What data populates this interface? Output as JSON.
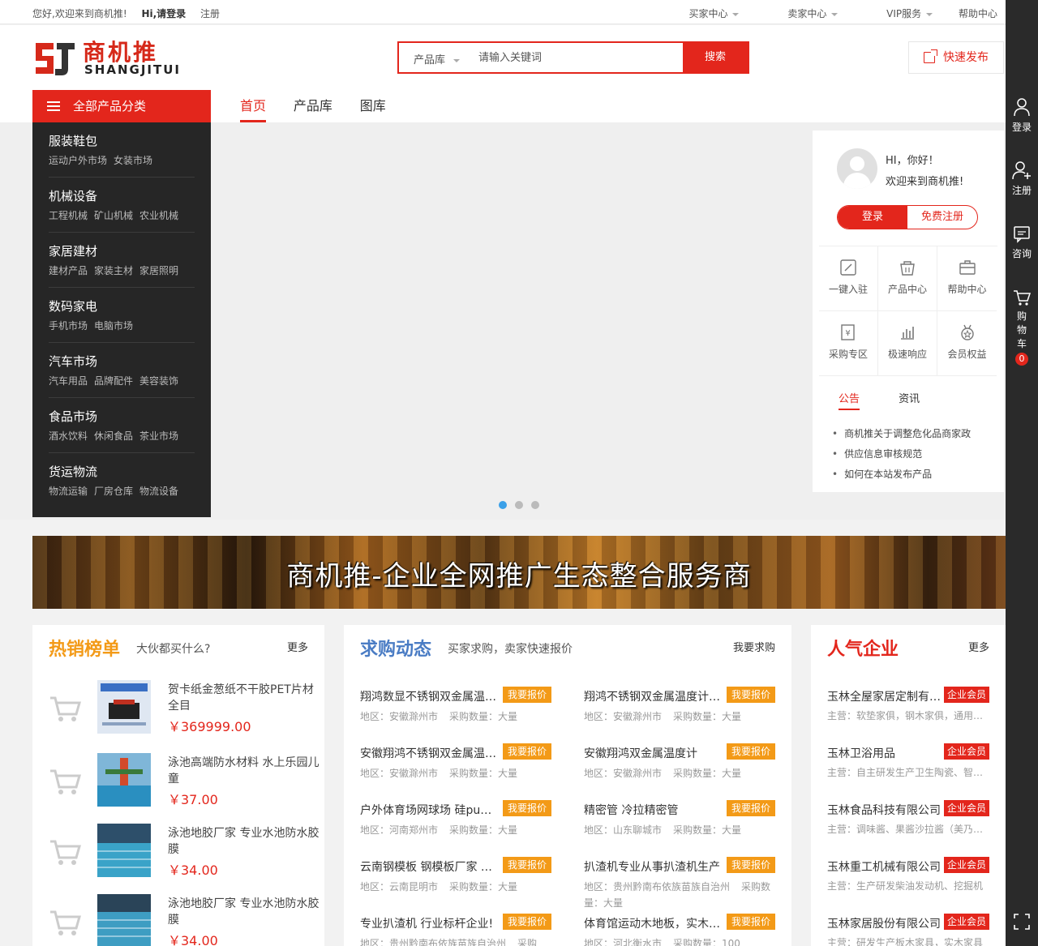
{
  "topbar": {
    "welcome": "您好,欢迎来到商机推!",
    "login": "Hi,请登录",
    "register": "注册",
    "menus": [
      "买家中心",
      "卖家中心",
      "VIP服务",
      "帮助中心"
    ]
  },
  "header": {
    "logo_cn": "商机推",
    "logo_en": "SHANGJITUI",
    "search_category": "产品库",
    "search_placeholder": "请输入关键词",
    "search_button": "搜索",
    "publish_button": "快速发布"
  },
  "nav": {
    "all_categories": "全部产品分类",
    "tabs": [
      "首页",
      "产品库",
      "图库"
    ]
  },
  "categories": [
    {
      "title": "服装鞋包",
      "subs": [
        "运动户外市场",
        "女装市场"
      ]
    },
    {
      "title": "机械设备",
      "subs": [
        "工程机械",
        "矿山机械",
        "农业机械"
      ]
    },
    {
      "title": "家居建材",
      "subs": [
        "建材产品",
        "家装主材",
        "家居照明"
      ]
    },
    {
      "title": "数码家电",
      "subs": [
        "手机市场",
        "电脑市场"
      ]
    },
    {
      "title": "汽车市场",
      "subs": [
        "汽车用品",
        "品牌配件",
        "美容装饰"
      ]
    },
    {
      "title": "食品市场",
      "subs": [
        "酒水饮料",
        "休闲食品",
        "茶业市场"
      ]
    },
    {
      "title": "货运物流",
      "subs": [
        "物流运输",
        "厂房仓库",
        "物流设备"
      ]
    }
  ],
  "user_panel": {
    "greeting1": "HI，你好！",
    "greeting2": "欢迎来到商机推!",
    "login": "登录",
    "register": "免费注册",
    "grid": [
      "一键入驻",
      "产品中心",
      "帮助中心",
      "采购专区",
      "极速响应",
      "会员权益"
    ],
    "tabs": [
      "公告",
      "资讯"
    ],
    "notices": [
      "商机推关于调整危化品商家政",
      "供应信息审核规范",
      "如何在本站发布产品"
    ]
  },
  "banner_text": "商机推-企业全网推广生态整合服务商",
  "hot": {
    "title": "热销榜单",
    "subtitle": "大伙都买什么?",
    "more": "更多",
    "items": [
      {
        "name": "贺卡纸金葱纸不干胶PET片材全目",
        "price": "￥369999.00"
      },
      {
        "name": "泳池高端防水材料 水上乐园儿童",
        "price": "￥37.00"
      },
      {
        "name": "泳池地胶厂家 专业水池防水胶膜",
        "price": "￥34.00"
      },
      {
        "name": "泳池地胶厂家 专业水池防水胶膜",
        "price": "￥34.00"
      }
    ]
  },
  "buy": {
    "title": "求购动态",
    "subtitle": "买家求购，卖家快速报价",
    "more": "我要求购",
    "quote_label": "我要报价",
    "items": [
      {
        "name": "翔鸿数显不锈钢双金属温度计",
        "region": "地区：安徽滁州市",
        "qty": "采购数量：大量"
      },
      {
        "name": "翔鸿不锈钢双金属温度计厂家",
        "region": "地区：安徽滁州市",
        "qty": "采购数量：大量"
      },
      {
        "name": "安徽翔鸿不锈钢双金属温度计",
        "region": "地区：安徽滁州市",
        "qty": "采购数量：大量"
      },
      {
        "name": "安徽翔鸿双金属温度计",
        "region": "地区：安徽滁州市",
        "qty": "采购数量：大量"
      },
      {
        "name": "户外体育场网球场 硅pu运动地面",
        "region": "地区：河南郑州市",
        "qty": "采购数量：大量"
      },
      {
        "name": "精密管 冷拉精密管",
        "region": "地区：山东聊城市",
        "qty": "采购数量：大量"
      },
      {
        "name": "云南钢模板 钢模板厂家 钢模板",
        "region": "地区：云南昆明市",
        "qty": "采购数量：大量"
      },
      {
        "name": "扒渣机专业从事扒渣机生产",
        "region": "地区：贵州黔南布依族苗族自治州",
        "qty": "采购数量：大量"
      },
      {
        "name": "专业扒渣机 行业标杆企业!",
        "region": "地区：贵州黔南布依族苗族自治州",
        "qty": "采购数"
      },
      {
        "name": "体育馆运动木地板，实木运动地板",
        "region": "地区：河北衡水市",
        "qty": "采购数量：100"
      }
    ]
  },
  "pop": {
    "title": "人气企业",
    "more": "更多",
    "vip_label": "企业会员",
    "items": [
      {
        "name": "玉林全屋家居定制有限公司",
        "main": "主营：软垫家俱，钢木家俱，通用家具"
      },
      {
        "name": "玉林卫浴用品",
        "main": "主营：自主研发生产卫生陶瓷、智能马桶"
      },
      {
        "name": "玉林食品科技有限公司",
        "main": "主营：调味酱、果酱沙拉酱（美乃滋）"
      },
      {
        "name": "玉林重工机械有限公司",
        "main": "主营：生产研发柴油发动机、挖掘机"
      },
      {
        "name": "玉林家居股份有限公司",
        "main": "主营：研发生产板木家具，实木家具"
      }
    ]
  },
  "sidebar": {
    "login": "登录",
    "register": "注册",
    "consult": "咨询",
    "cart": "购物车",
    "cart_count": "0"
  }
}
